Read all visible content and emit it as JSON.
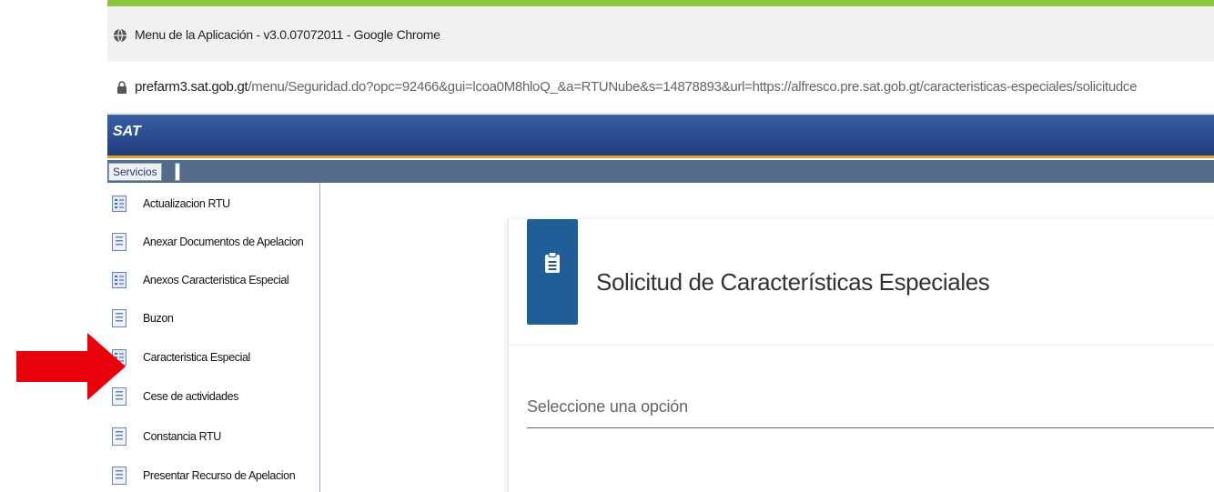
{
  "window": {
    "title": "Menu de la Aplicación - v3.0.07072011 - Google Chrome"
  },
  "address": {
    "host": "prefarm3.sat.gob.gt",
    "path": "/menu/Seguridad.do?opc=92466&gui=lcoa0M8hloQ_&a=RTUNube&s=14878893&url=https://alfresco.pre.sat.gob.gt/caracteristicas-especiales/solicitudce"
  },
  "header": {
    "logo": "SAT"
  },
  "menubar": {
    "tab_label": "Servicios"
  },
  "dropdown": {
    "items": [
      {
        "label": "Actualizacion RTU",
        "icon": "list-doc-icon"
      },
      {
        "label": "Anexar Documentos de Apelacion",
        "icon": "doc-icon"
      },
      {
        "label": "Anexos Caracteristica Especial",
        "icon": "list-doc-icon"
      },
      {
        "label": "Buzon",
        "icon": "doc-icon"
      },
      {
        "label": "Caracteristica Especial",
        "icon": "list-doc-icon"
      },
      {
        "label": "Cese de actividades",
        "icon": "doc-icon"
      },
      {
        "label": "Constancia RTU",
        "icon": "doc-icon"
      },
      {
        "label": "Presentar Recurso de Apelacion",
        "icon": "doc-icon"
      }
    ]
  },
  "card": {
    "title": "Solicitud de Características Especiales",
    "icon": "clipboard-icon",
    "select_placeholder": "Seleccione una opción"
  },
  "colors": {
    "accent_green": "#8cc63f",
    "sat_blue": "#2a4a8e",
    "card_icon_bg": "#1f5e96",
    "annotation_red": "#e8000b"
  }
}
